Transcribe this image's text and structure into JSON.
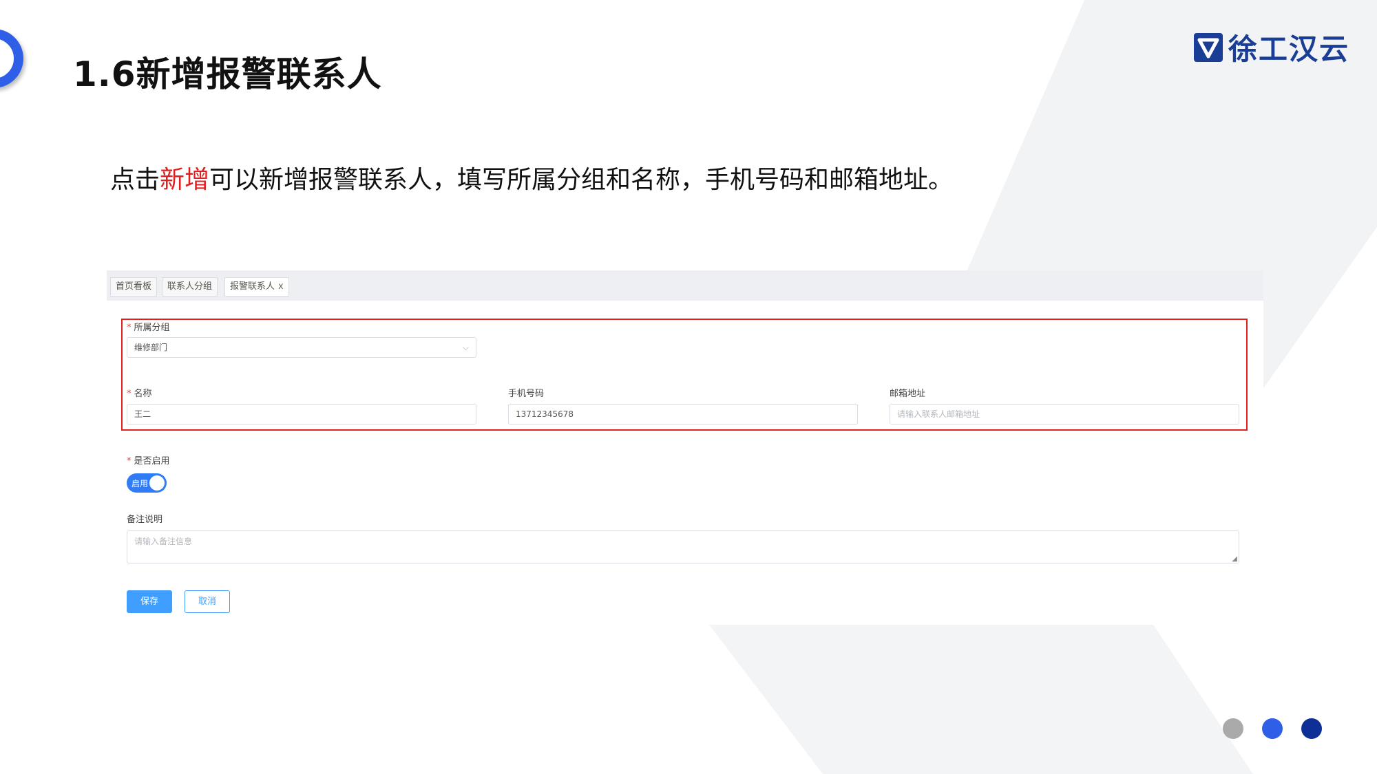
{
  "slide": {
    "title": "1.6新增报警联系人",
    "logo_text": "徐工汉云",
    "description": {
      "part1": "点击",
      "highlight": "新增",
      "part2": "可以新增报警联系人，填写所属分组和名称，手机号码和邮箱地址。"
    }
  },
  "tabs": [
    {
      "label": "首页看板"
    },
    {
      "label": "联系人分组"
    },
    {
      "label": "报警联系人",
      "close": "x"
    }
  ],
  "form": {
    "required_mark": "*",
    "group": {
      "label": "所属分组",
      "value": "维修部门",
      "chevron": "⌵"
    },
    "name": {
      "label": "名称",
      "value": "王二"
    },
    "phone": {
      "label": "手机号码",
      "value": "13712345678"
    },
    "email": {
      "label": "邮箱地址",
      "placeholder": "请输入联系人邮箱地址"
    },
    "enabled": {
      "label": "是否启用",
      "toggle_text": "启用",
      "on": true
    },
    "remark": {
      "label": "备注说明",
      "placeholder": "请输入备注信息"
    },
    "save_label": "保存",
    "cancel_label": "取消"
  },
  "colors": {
    "accent_blue": "#2f5fe6",
    "highlight_red": "#e02020",
    "button_blue": "#409eff",
    "dot_gray": "#aaaaaa",
    "dot_blue": "#2f5fe6",
    "dot_navy": "#0e2f96"
  }
}
